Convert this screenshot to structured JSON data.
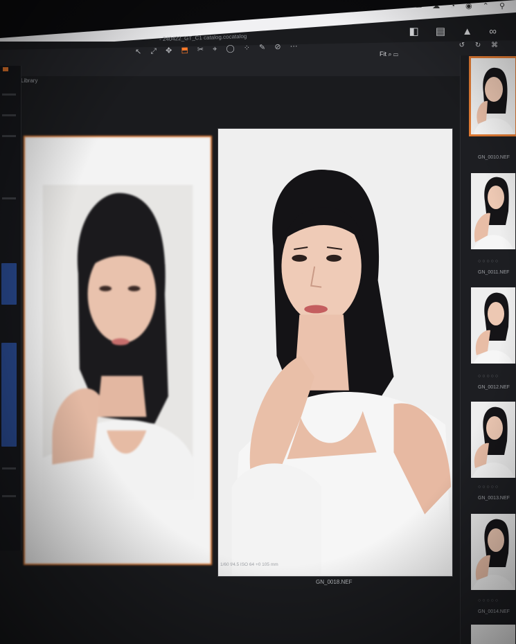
{
  "app": {
    "doc_title": "- 240422_GT_C1 catalog.cocatalog",
    "top_left_label": "Library"
  },
  "toolbar": {
    "tools": [
      "↖",
      "⤢",
      "✥",
      "⬒",
      "✂",
      "⌖",
      "◯",
      "⁘",
      "✎",
      "⊘",
      "⋯"
    ],
    "right_tools": [
      "◧",
      "▤",
      "▲",
      "∞"
    ],
    "right_tools2": [
      "↺",
      "↻",
      "⌘"
    ],
    "zoom_readout": "Fit ⌕ ▭"
  },
  "menubar": {
    "icons": "✉ ☁ ◔ ◉ ⌃ ⚲"
  },
  "viewer": {
    "primary_filename": "GN_0018.NEF",
    "primary_meta": "1/60 f/4.5   ISO 64   +0   105 mm"
  },
  "filmstrip": {
    "items": [
      {
        "label": "GN_0010.NEF",
        "stars": "○○○○○"
      },
      {
        "label": "GN_0011.NEF",
        "stars": "○○○○○"
      },
      {
        "label": "GN_0012.NEF",
        "stars": "○○○○○"
      },
      {
        "label": "GN_0013.NEF",
        "stars": "○○○○○"
      },
      {
        "label": "GN_0014.NEF",
        "stars": "○○○○○"
      }
    ]
  },
  "colors": {
    "accent": "#e07a33",
    "panel": "#1d1e22",
    "background": "#0a0a0c"
  }
}
